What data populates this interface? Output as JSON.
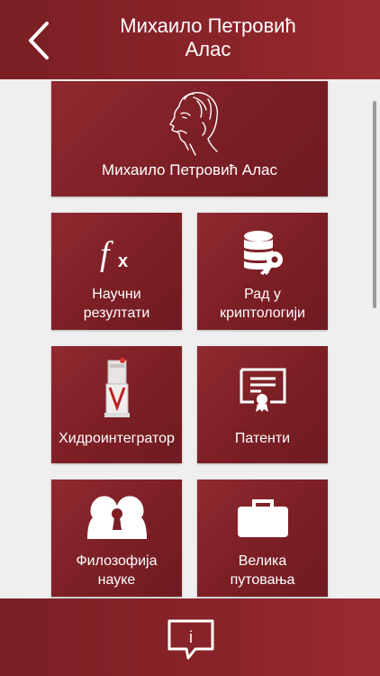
{
  "header": {
    "title_line1": "Михаило Петровић",
    "title_line2": "Алас"
  },
  "hero": {
    "label": "Михаило Петровић Алас"
  },
  "tiles": [
    {
      "line1": "Научни",
      "line2": "резултати",
      "icon": "function-icon"
    },
    {
      "line1": "Рад у",
      "line2": "криптологији",
      "icon": "database-key-icon"
    },
    {
      "line1": "Хидроинтегратор",
      "line2": "",
      "icon": "hydrointegrator-icon"
    },
    {
      "line1": "Патенти",
      "line2": "",
      "icon": "certificate-icon"
    },
    {
      "line1": "Филозофија",
      "line2": "науке",
      "icon": "heads-keyhole-icon"
    },
    {
      "line1": "Велика",
      "line2": "путовања",
      "icon": "briefcase-icon"
    }
  ],
  "footer": {
    "info_symbol": "i"
  },
  "colors": {
    "brand": "#8a242a",
    "background": "#efefef",
    "text": "#ffffff"
  }
}
